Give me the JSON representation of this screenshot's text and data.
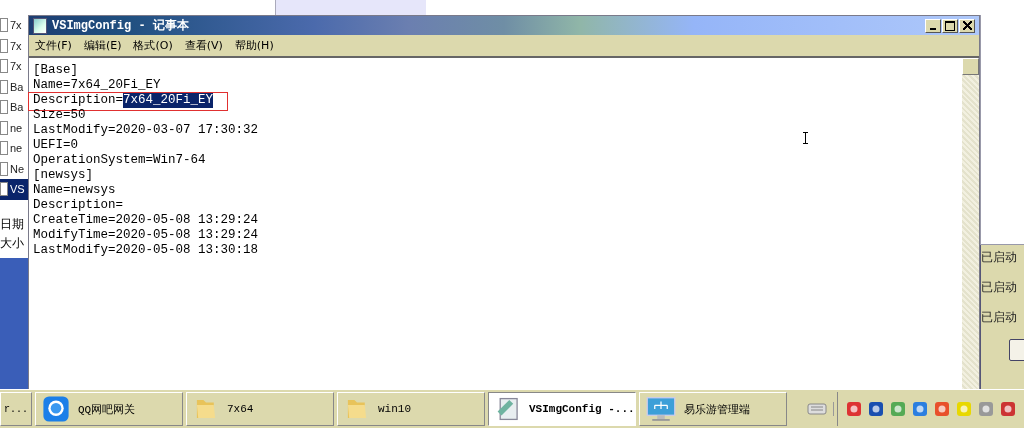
{
  "explorer": {
    "files": [
      {
        "label": "7x",
        "selected": false
      },
      {
        "label": "7x",
        "selected": false
      },
      {
        "label": "7x",
        "selected": false
      },
      {
        "label": "Ba",
        "selected": false
      },
      {
        "label": "Ba",
        "selected": false
      },
      {
        "label": "ne",
        "selected": false
      },
      {
        "label": "ne",
        "selected": false
      },
      {
        "label": "Ne",
        "selected": false
      },
      {
        "label": "VS",
        "selected": true
      }
    ],
    "details": [
      "日期",
      "大小"
    ]
  },
  "notepad": {
    "title": "VSImgConfig - 记事本",
    "menu": [
      "文件(F)",
      "编辑(E)",
      "格式(O)",
      "查看(V)",
      "帮助(H)"
    ],
    "lines": [
      {
        "text": "[Base]"
      },
      {
        "text": "Name=7x64_20Fi_EY"
      },
      {
        "text": "Description=",
        "selection": "7x64_20Fi_EY",
        "annotated": true
      },
      {
        "text": "Size=50"
      },
      {
        "text": "LastModify=2020-03-07 17:30:32"
      },
      {
        "text": "UEFI=0"
      },
      {
        "text": "OperationSystem=Win7-64"
      },
      {
        "text": "[newsys]"
      },
      {
        "text": "Name=newsys"
      },
      {
        "text": "Description="
      },
      {
        "text": "CreateTime=2020-05-08 13:29:24"
      },
      {
        "text": "ModifyTime=2020-05-08 13:29:24"
      },
      {
        "text": "LastModify=2020-05-08 13:30:18"
      }
    ]
  },
  "services": {
    "statuses": [
      "已启动",
      "已启动",
      "已启动"
    ]
  },
  "taskbar": {
    "buttons": [
      {
        "label": "r...",
        "kind": "plain",
        "selected": false
      },
      {
        "label": "QQ网吧网关",
        "kind": "chat",
        "selected": false
      },
      {
        "label": "7x64",
        "kind": "folder",
        "selected": false
      },
      {
        "label": "win10",
        "kind": "folder",
        "selected": false
      },
      {
        "label": "VSImgConfig -...",
        "kind": "notepad",
        "selected": true
      },
      {
        "label": "易乐游管理端",
        "kind": "monitor",
        "selected": false
      }
    ]
  }
}
